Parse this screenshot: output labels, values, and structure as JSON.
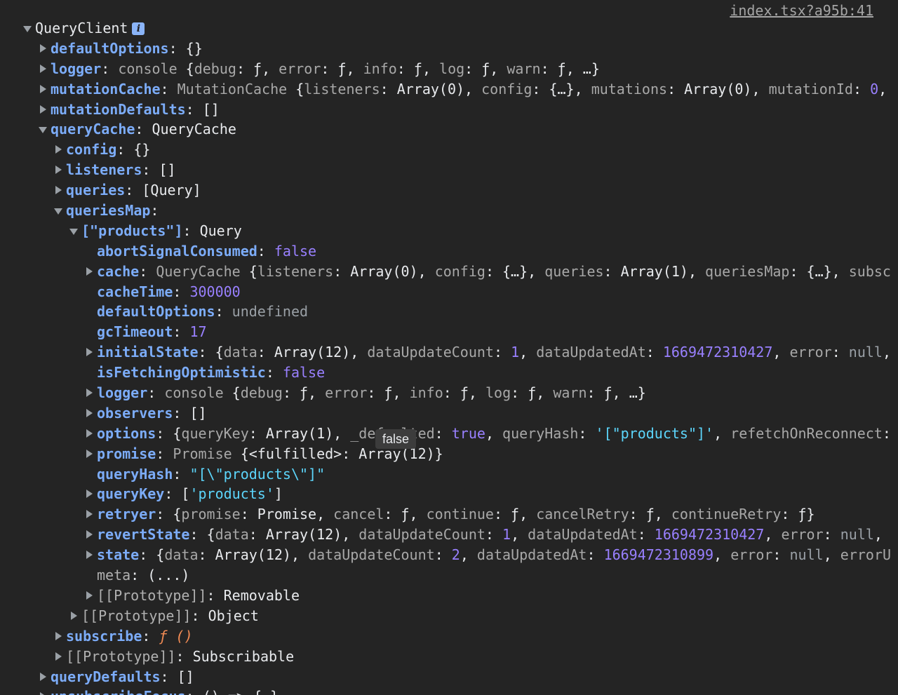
{
  "source_link": "index.tsx?a95b:41",
  "tooltip": "false",
  "rows": [
    {
      "d": 0,
      "t": "e",
      "tokens": [
        [
          "p",
          "QueryClient"
        ]
      ],
      "badge": "i"
    },
    {
      "d": 1,
      "t": "c",
      "tokens": [
        [
          "k",
          "defaultOptions"
        ],
        [
          "p",
          ": {}"
        ]
      ]
    },
    {
      "d": 1,
      "t": "c",
      "tokens": [
        [
          "k",
          "logger"
        ],
        [
          "p",
          ": "
        ],
        [
          "dim",
          "console "
        ],
        [
          "p",
          "{"
        ],
        [
          "dim",
          "debug"
        ],
        [
          "p",
          ": "
        ],
        [
          "p",
          "ƒ"
        ],
        [
          "p",
          ", "
        ],
        [
          "dim",
          "error"
        ],
        [
          "p",
          ": "
        ],
        [
          "p",
          "ƒ"
        ],
        [
          "p",
          ", "
        ],
        [
          "dim",
          "info"
        ],
        [
          "p",
          ": "
        ],
        [
          "p",
          "ƒ"
        ],
        [
          "p",
          ", "
        ],
        [
          "dim",
          "log"
        ],
        [
          "p",
          ": "
        ],
        [
          "p",
          "ƒ"
        ],
        [
          "p",
          ", "
        ],
        [
          "dim",
          "warn"
        ],
        [
          "p",
          ": "
        ],
        [
          "p",
          "ƒ"
        ],
        [
          "p",
          ", …}"
        ]
      ]
    },
    {
      "d": 1,
      "t": "c",
      "tokens": [
        [
          "k",
          "mutationCache"
        ],
        [
          "p",
          ": "
        ],
        [
          "dim",
          "MutationCache "
        ],
        [
          "p",
          "{"
        ],
        [
          "dim",
          "listeners"
        ],
        [
          "p",
          ": Array(0), "
        ],
        [
          "dim",
          "config"
        ],
        [
          "p",
          ": {…}, "
        ],
        [
          "dim",
          "mutations"
        ],
        [
          "p",
          ": Array(0), "
        ],
        [
          "dim",
          "mutationId"
        ],
        [
          "p",
          ": "
        ],
        [
          "num",
          "0"
        ],
        [
          "p",
          ","
        ]
      ]
    },
    {
      "d": 1,
      "t": "c",
      "tokens": [
        [
          "k",
          "mutationDefaults"
        ],
        [
          "p",
          ": []"
        ]
      ]
    },
    {
      "d": 1,
      "t": "e",
      "tokens": [
        [
          "k",
          "queryCache"
        ],
        [
          "p",
          ": QueryCache"
        ]
      ]
    },
    {
      "d": 2,
      "t": "c",
      "tokens": [
        [
          "k",
          "config"
        ],
        [
          "p",
          ": {}"
        ]
      ]
    },
    {
      "d": 2,
      "t": "c",
      "tokens": [
        [
          "k",
          "listeners"
        ],
        [
          "p",
          ": []"
        ]
      ]
    },
    {
      "d": 2,
      "t": "c",
      "tokens": [
        [
          "k",
          "queries"
        ],
        [
          "p",
          ": [Query]"
        ]
      ]
    },
    {
      "d": 2,
      "t": "e",
      "tokens": [
        [
          "k",
          "queriesMap"
        ],
        [
          "p",
          ":"
        ]
      ]
    },
    {
      "d": 3,
      "t": "e",
      "tokens": [
        [
          "k",
          "[\"products\"]"
        ],
        [
          "p",
          ": Query"
        ]
      ]
    },
    {
      "d": 4,
      "t": "n",
      "tokens": [
        [
          "k",
          "abortSignalConsumed"
        ],
        [
          "p",
          ": "
        ],
        [
          "bool",
          "false"
        ]
      ]
    },
    {
      "d": 4,
      "t": "c",
      "tokens": [
        [
          "k",
          "cache"
        ],
        [
          "p",
          ": "
        ],
        [
          "dim",
          "QueryCache "
        ],
        [
          "p",
          "{"
        ],
        [
          "dim",
          "listeners"
        ],
        [
          "p",
          ": Array(0), "
        ],
        [
          "dim",
          "config"
        ],
        [
          "p",
          ": {…}, "
        ],
        [
          "dim",
          "queries"
        ],
        [
          "p",
          ": Array(1), "
        ],
        [
          "dim",
          "queriesMap"
        ],
        [
          "p",
          ": {…}, "
        ],
        [
          "dim",
          "subsc"
        ]
      ]
    },
    {
      "d": 4,
      "t": "n",
      "tokens": [
        [
          "k",
          "cacheTime"
        ],
        [
          "p",
          ": "
        ],
        [
          "num",
          "300000"
        ]
      ]
    },
    {
      "d": 4,
      "t": "n",
      "tokens": [
        [
          "k",
          "defaultOptions"
        ],
        [
          "p",
          ": "
        ],
        [
          "null",
          "undefined"
        ]
      ]
    },
    {
      "d": 4,
      "t": "n",
      "tokens": [
        [
          "k",
          "gcTimeout"
        ],
        [
          "p",
          ": "
        ],
        [
          "num",
          "17"
        ]
      ]
    },
    {
      "d": 4,
      "t": "c",
      "tokens": [
        [
          "k",
          "initialState"
        ],
        [
          "p",
          ": {"
        ],
        [
          "dim",
          "data"
        ],
        [
          "p",
          ": Array(12), "
        ],
        [
          "dim",
          "dataUpdateCount"
        ],
        [
          "p",
          ": "
        ],
        [
          "num",
          "1"
        ],
        [
          "p",
          ", "
        ],
        [
          "dim",
          "dataUpdatedAt"
        ],
        [
          "p",
          ": "
        ],
        [
          "num",
          "1669472310427"
        ],
        [
          "p",
          ", "
        ],
        [
          "dim",
          "error"
        ],
        [
          "p",
          ": "
        ],
        [
          "null",
          "null"
        ],
        [
          "p",
          ","
        ]
      ]
    },
    {
      "d": 4,
      "t": "n",
      "tokens": [
        [
          "k",
          "isFetchingOptimistic"
        ],
        [
          "p",
          ": "
        ],
        [
          "bool",
          "false"
        ]
      ]
    },
    {
      "d": 4,
      "t": "c",
      "tokens": [
        [
          "k",
          "logger"
        ],
        [
          "p",
          ": "
        ],
        [
          "dim",
          "console "
        ],
        [
          "p",
          "{"
        ],
        [
          "dim",
          "debug"
        ],
        [
          "p",
          ": ƒ, "
        ],
        [
          "dim",
          "error"
        ],
        [
          "p",
          ": ƒ, "
        ],
        [
          "dim",
          "info"
        ],
        [
          "p",
          ": ƒ, "
        ],
        [
          "dim",
          "log"
        ],
        [
          "p",
          ": ƒ, "
        ],
        [
          "dim",
          "warn"
        ],
        [
          "p",
          ": ƒ, …}"
        ]
      ]
    },
    {
      "d": 4,
      "t": "c",
      "tokens": [
        [
          "k",
          "observers"
        ],
        [
          "p",
          ": []"
        ]
      ]
    },
    {
      "d": 4,
      "t": "c",
      "tokens": [
        [
          "k",
          "options"
        ],
        [
          "p",
          ": {"
        ],
        [
          "dim",
          "queryKey"
        ],
        [
          "p",
          ": Array(1), "
        ],
        [
          "dim",
          "_defaulted"
        ],
        [
          "p",
          ": "
        ],
        [
          "bool",
          "true"
        ],
        [
          "p",
          ", "
        ],
        [
          "dim",
          "queryHash"
        ],
        [
          "p",
          ": "
        ],
        [
          "str",
          "'[\"products\"]'"
        ],
        [
          "p",
          ", "
        ],
        [
          "dim",
          "refetchOnReconnect"
        ],
        [
          "p",
          ":"
        ]
      ]
    },
    {
      "d": 4,
      "t": "c",
      "tokens": [
        [
          "k",
          "promise"
        ],
        [
          "p",
          ": "
        ],
        [
          "dim",
          "Promise "
        ],
        [
          "p",
          "{<fulfilled>: Array(12)}"
        ]
      ]
    },
    {
      "d": 4,
      "t": "n",
      "tokens": [
        [
          "k",
          "queryHash"
        ],
        [
          "p",
          ": "
        ],
        [
          "str",
          "\"[\\\"products\\\"]\""
        ]
      ]
    },
    {
      "d": 4,
      "t": "c",
      "tokens": [
        [
          "k",
          "queryKey"
        ],
        [
          "p",
          ": ["
        ],
        [
          "str",
          "'products'"
        ],
        [
          "p",
          "]"
        ]
      ]
    },
    {
      "d": 4,
      "t": "c",
      "tokens": [
        [
          "k",
          "retryer"
        ],
        [
          "p",
          ": {"
        ],
        [
          "dim",
          "promise"
        ],
        [
          "p",
          ": Promise, "
        ],
        [
          "dim",
          "cancel"
        ],
        [
          "p",
          ": ƒ, "
        ],
        [
          "dim",
          "continue"
        ],
        [
          "p",
          ": ƒ, "
        ],
        [
          "dim",
          "cancelRetry"
        ],
        [
          "p",
          ": ƒ, "
        ],
        [
          "dim",
          "continueRetry"
        ],
        [
          "p",
          ": ƒ}"
        ]
      ]
    },
    {
      "d": 4,
      "t": "c",
      "tokens": [
        [
          "k",
          "revertState"
        ],
        [
          "p",
          ": {"
        ],
        [
          "dim",
          "data"
        ],
        [
          "p",
          ": Array(12), "
        ],
        [
          "dim",
          "dataUpdateCount"
        ],
        [
          "p",
          ": "
        ],
        [
          "num",
          "1"
        ],
        [
          "p",
          ", "
        ],
        [
          "dim",
          "dataUpdatedAt"
        ],
        [
          "p",
          ": "
        ],
        [
          "num",
          "1669472310427"
        ],
        [
          "p",
          ", "
        ],
        [
          "dim",
          "error"
        ],
        [
          "p",
          ": "
        ],
        [
          "null",
          "null"
        ],
        [
          "p",
          ","
        ]
      ]
    },
    {
      "d": 4,
      "t": "c",
      "tokens": [
        [
          "k",
          "state"
        ],
        [
          "p",
          ": {"
        ],
        [
          "dim",
          "data"
        ],
        [
          "p",
          ": Array(12), "
        ],
        [
          "dim",
          "dataUpdateCount"
        ],
        [
          "p",
          ": "
        ],
        [
          "num",
          "2"
        ],
        [
          "p",
          ", "
        ],
        [
          "dim",
          "dataUpdatedAt"
        ],
        [
          "p",
          ": "
        ],
        [
          "num",
          "1669472310899"
        ],
        [
          "p",
          ", "
        ],
        [
          "dim",
          "error"
        ],
        [
          "p",
          ": "
        ],
        [
          "null",
          "null"
        ],
        [
          "p",
          ", "
        ],
        [
          "dim",
          "errorU"
        ]
      ]
    },
    {
      "d": 4,
      "t": "n",
      "tokens": [
        [
          "proto",
          "meta"
        ],
        [
          "p",
          ": (...)"
        ]
      ]
    },
    {
      "d": 4,
      "t": "c",
      "tokens": [
        [
          "proto",
          "[[Prototype]]"
        ],
        [
          "p",
          ": Removable"
        ]
      ]
    },
    {
      "d": 3,
      "t": "c",
      "tokens": [
        [
          "proto",
          "[[Prototype]]"
        ],
        [
          "p",
          ": Object"
        ]
      ]
    },
    {
      "d": 2,
      "t": "c",
      "tokens": [
        [
          "k",
          "subscribe"
        ],
        [
          "p",
          ": "
        ],
        [
          "fn",
          "ƒ ()"
        ]
      ]
    },
    {
      "d": 2,
      "t": "c",
      "tokens": [
        [
          "proto",
          "[[Prototype]]"
        ],
        [
          "p",
          ": Subscribable"
        ]
      ]
    },
    {
      "d": 1,
      "t": "c",
      "tokens": [
        [
          "k",
          "queryDefaults"
        ],
        [
          "p",
          ": []"
        ]
      ]
    },
    {
      "d": 1,
      "t": "c",
      "tokens": [
        [
          "k",
          "unsubscribeFocus"
        ],
        [
          "p",
          ": () => {…}"
        ]
      ]
    }
  ]
}
